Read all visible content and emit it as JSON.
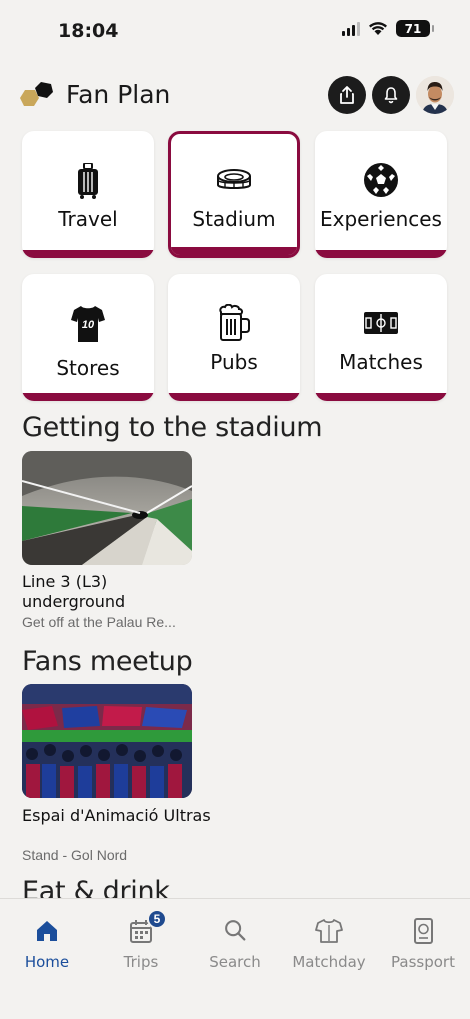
{
  "status_bar": {
    "time": "18:04",
    "battery": "71"
  },
  "header": {
    "app_title": "Fan Plan"
  },
  "categories": [
    {
      "label": "Travel",
      "icon": "suitcase-icon",
      "selected": false
    },
    {
      "label": "Stadium",
      "icon": "stadium-icon",
      "selected": true
    },
    {
      "label": "Experiences",
      "icon": "football-icon",
      "selected": false
    },
    {
      "label": "Stores",
      "icon": "jersey-icon",
      "jersey_number": "10",
      "selected": false
    },
    {
      "label": "Pubs",
      "icon": "beer-mug-icon",
      "selected": false
    },
    {
      "label": "Matches",
      "icon": "pitch-icon",
      "selected": false
    }
  ],
  "sections": [
    {
      "title": "Getting to the stadium",
      "cards": [
        {
          "title": "Line 3 (L3) underground",
          "subtitle": "Get off at the Palau Re..."
        }
      ]
    },
    {
      "title": "Fans meetup",
      "cards": [
        {
          "title": "Espai d'Animació Ultras",
          "subtitle": "Stand - Gol Nord"
        }
      ]
    },
    {
      "title": "Eat & drink",
      "cards": []
    }
  ],
  "tabbar": {
    "tabs": [
      {
        "label": "Home",
        "icon": "home-icon",
        "active": true
      },
      {
        "label": "Trips",
        "icon": "calendar-icon",
        "badge": "5",
        "active": false
      },
      {
        "label": "Search",
        "icon": "search-icon",
        "active": false
      },
      {
        "label": "Matchday",
        "icon": "shirt-icon",
        "active": false
      },
      {
        "label": "Passport",
        "icon": "passport-icon",
        "active": false
      }
    ]
  },
  "colors": {
    "accent": "#8a0b3f",
    "active_tab": "#1b4e9b",
    "background": "#f3f2f0"
  }
}
